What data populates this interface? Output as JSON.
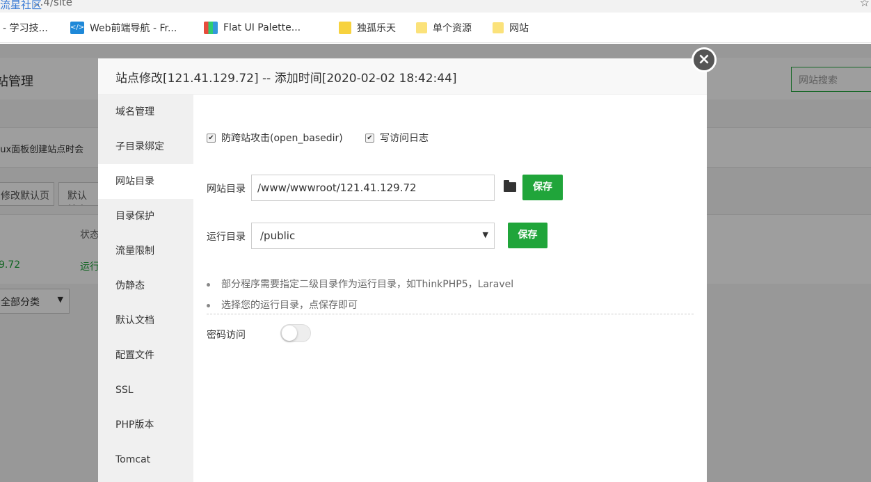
{
  "browser": {
    "url_fragment": "...4/site",
    "watermark": "流星社区",
    "bookmarks": [
      {
        "label": "- 学习技...",
        "icon": "bookmark-icon"
      },
      {
        "label": "Web前端导航 - Fr...",
        "icon": "code-icon"
      },
      {
        "label": "Flat UI Palette...",
        "icon": "palette-icon"
      },
      {
        "label": "独孤乐天",
        "icon": "face-icon"
      },
      {
        "label": "单个资源",
        "icon": "folder-icon"
      },
      {
        "label": "网站",
        "icon": "folder-icon"
      }
    ]
  },
  "background_page": {
    "title": "站管理",
    "search_placeholder": "网站搜索",
    "notice": "nux面板创建站点时会",
    "button_default_page": "修改默认页",
    "button_default_site": "默认站点",
    "column_status": "状态",
    "row_ip": "9.72",
    "row_status": "运行",
    "category_select": "全部分类"
  },
  "modal": {
    "title": "站点修改[121.41.129.72] -- 添加时间[2020-02-02 18:42:44]",
    "menu": [
      {
        "label": "域名管理",
        "active": false
      },
      {
        "label": "子目录绑定",
        "active": false
      },
      {
        "label": "网站目录",
        "active": true
      },
      {
        "label": "目录保护",
        "active": false
      },
      {
        "label": "流量限制",
        "active": false
      },
      {
        "label": "伪静态",
        "active": false
      },
      {
        "label": "默认文档",
        "active": false
      },
      {
        "label": "配置文件",
        "active": false
      },
      {
        "label": "SSL",
        "active": false
      },
      {
        "label": "PHP版本",
        "active": false
      },
      {
        "label": "Tomcat",
        "active": false
      }
    ],
    "checkbox_basedir": {
      "label": "防跨站攻击(open_basedir)",
      "checked": true
    },
    "checkbox_log": {
      "label": "写访问日志",
      "checked": true
    },
    "site_dir": {
      "label": "网站目录",
      "value": "/www/wwwroot/121.41.129.72",
      "save": "保存"
    },
    "run_dir": {
      "label": "运行目录",
      "value": "/public",
      "save": "保存"
    },
    "tips": [
      "部分程序需要指定二级目录作为运行目录，如ThinkPHP5，Laravel",
      "选择您的运行目录，点保存即可"
    ],
    "password_access": {
      "label": "密码访问",
      "enabled": false
    }
  },
  "colors": {
    "accent": "#20a53a",
    "overlay": "rgba(0,0,0,0.38)"
  }
}
